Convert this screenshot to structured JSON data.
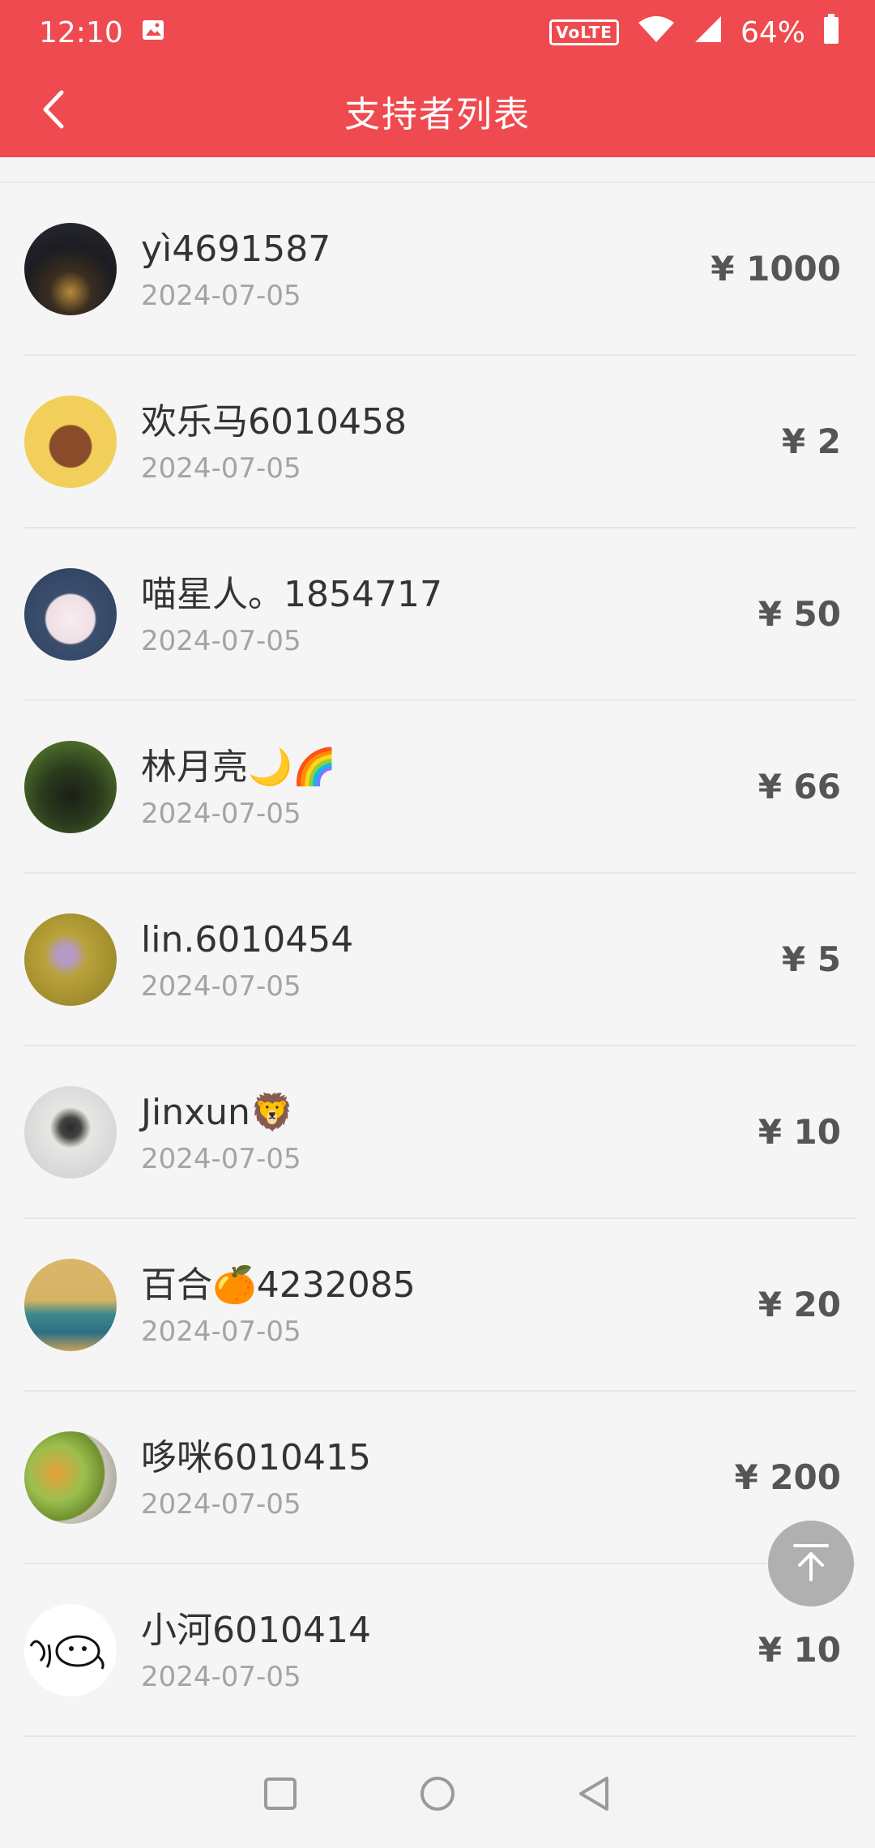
{
  "status_bar": {
    "time": "12:10",
    "volte": "VoLTE",
    "battery": "64%",
    "icons": [
      "image-icon",
      "wifi-icon",
      "signal-icon",
      "battery-icon"
    ]
  },
  "header": {
    "title": "支持者列表",
    "back_icon": "chevron-left-icon"
  },
  "colors": {
    "accent": "#ef4a4f",
    "amount_text": "#555555",
    "date_text": "#a4a4a4"
  },
  "supporters": [
    {
      "name": "yì4691587",
      "date": "2024-07-05",
      "amount": "¥ 1000"
    },
    {
      "name": "欢乐马6010458",
      "date": "2024-07-05",
      "amount": "¥ 2"
    },
    {
      "name": "喵星人。1854717",
      "date": "2024-07-05",
      "amount": "¥ 50"
    },
    {
      "name": "林月亮🌙🌈",
      "date": "2024-07-05",
      "amount": "¥ 66"
    },
    {
      "name": "lin.6010454",
      "date": "2024-07-05",
      "amount": "¥ 5"
    },
    {
      "name": "Jinxun🦁",
      "date": "2024-07-05",
      "amount": "¥ 10"
    },
    {
      "name": "百合🍊4232085",
      "date": "2024-07-05",
      "amount": "¥ 20"
    },
    {
      "name": "哆咪6010415",
      "date": "2024-07-05",
      "amount": "¥ 200"
    },
    {
      "name": "小河6010414",
      "date": "2024-07-05",
      "amount": "¥ 10"
    }
  ],
  "fab": {
    "icon": "arrow-up-to-top-icon"
  },
  "nav_bar": {
    "icons": [
      "recents-square-icon",
      "home-circle-icon",
      "back-triangle-icon"
    ]
  }
}
